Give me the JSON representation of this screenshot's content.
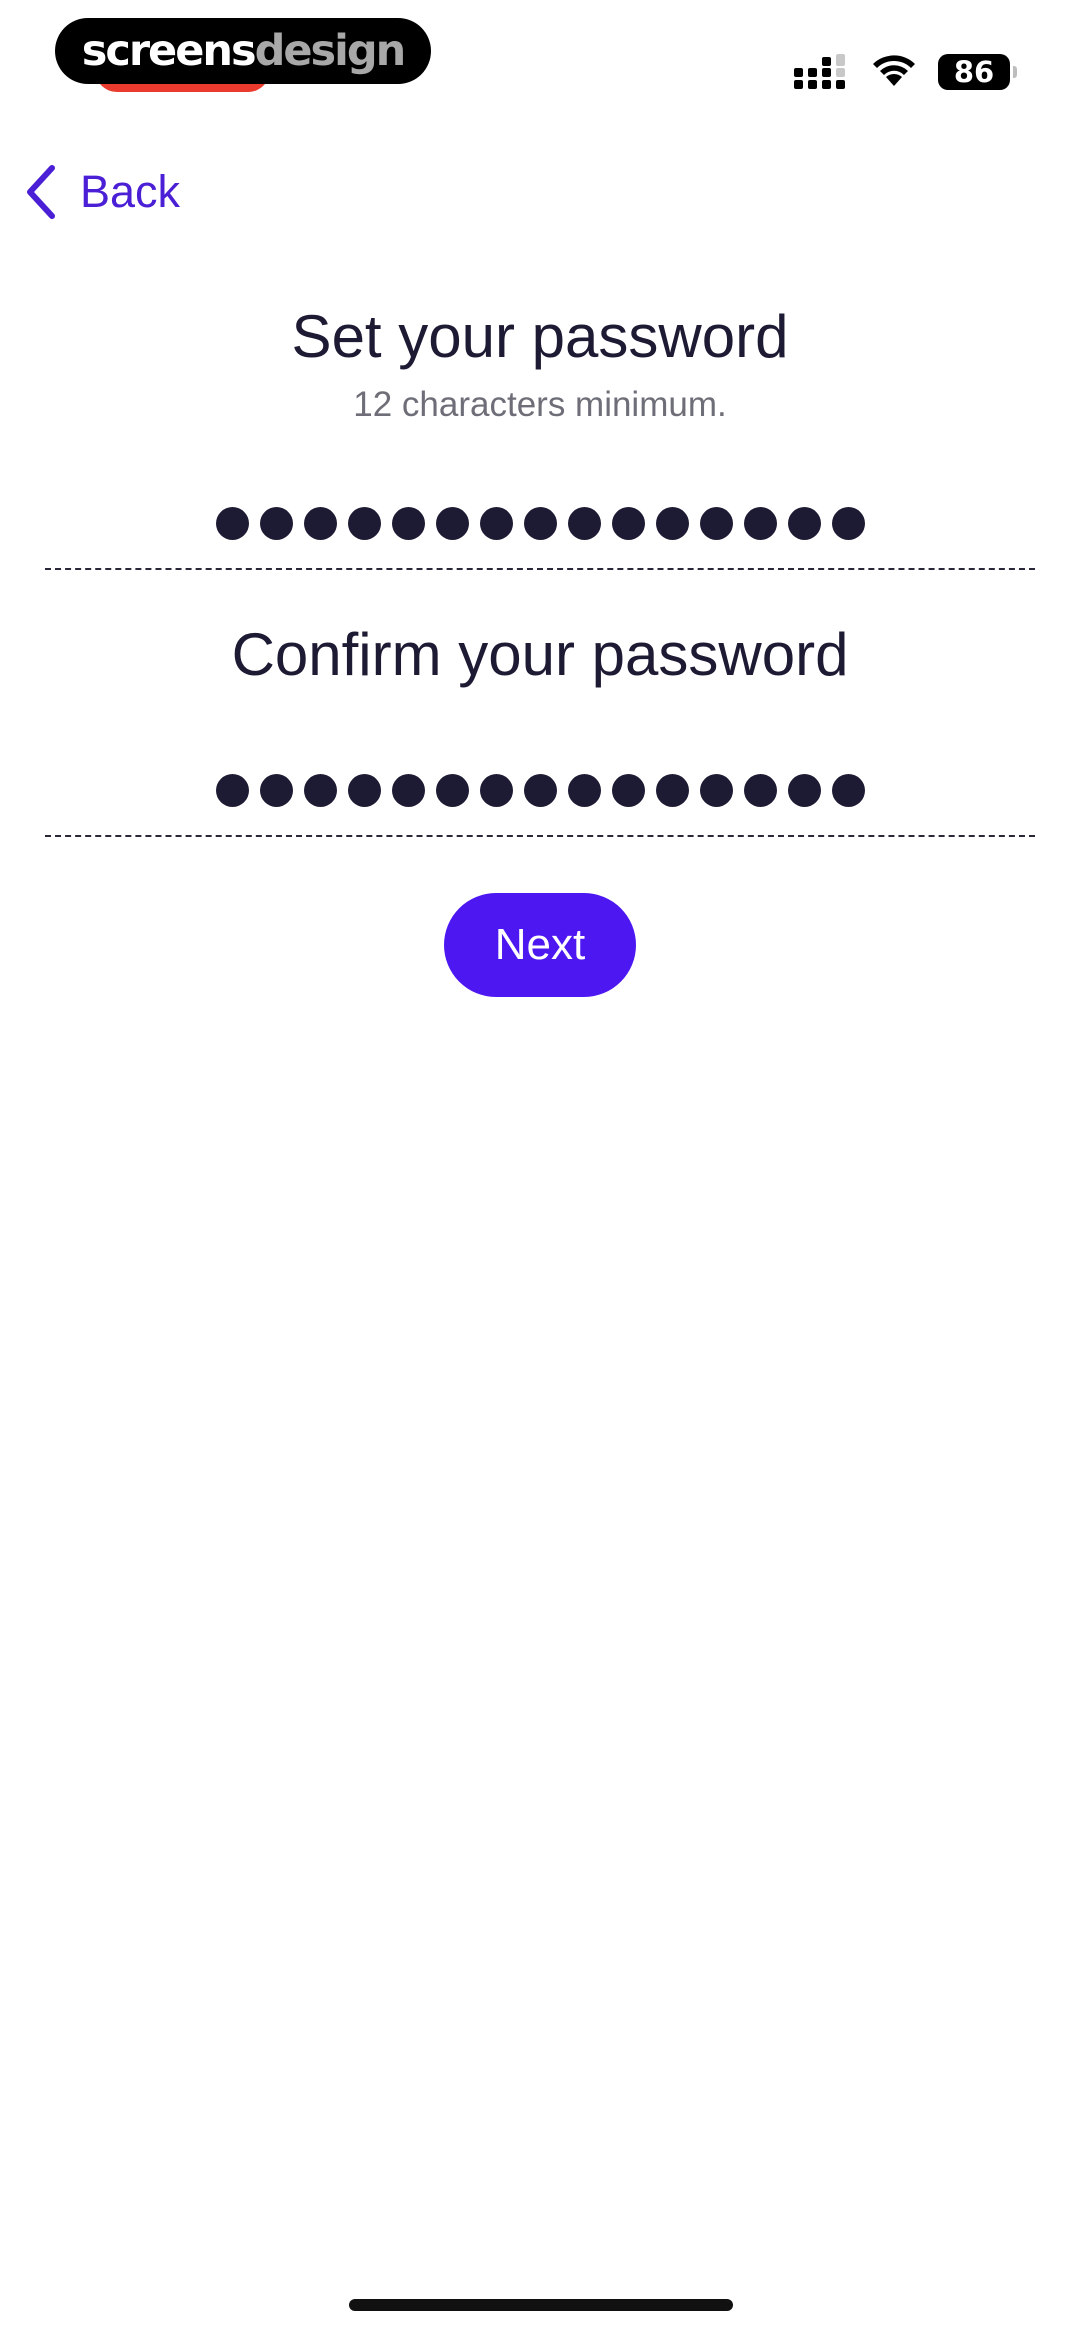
{
  "status_bar": {
    "battery_level": "86",
    "watermark": {
      "part1": "screens",
      "part2": "design"
    },
    "colors": {
      "recording": "#ea3b2e"
    }
  },
  "nav": {
    "back_label": "Back",
    "back_icon": "chevron-left-icon"
  },
  "password_section": {
    "title": "Set your password",
    "hint": "12 characters minimum.",
    "masked_length": 15
  },
  "confirm_section": {
    "title": "Confirm your password",
    "masked_length": 15
  },
  "actions": {
    "next_label": "Next"
  },
  "colors": {
    "accent": "#4d17f2",
    "back_link": "#4a1fd6",
    "text_primary": "#1d1a33",
    "text_secondary": "#6e6e78"
  }
}
